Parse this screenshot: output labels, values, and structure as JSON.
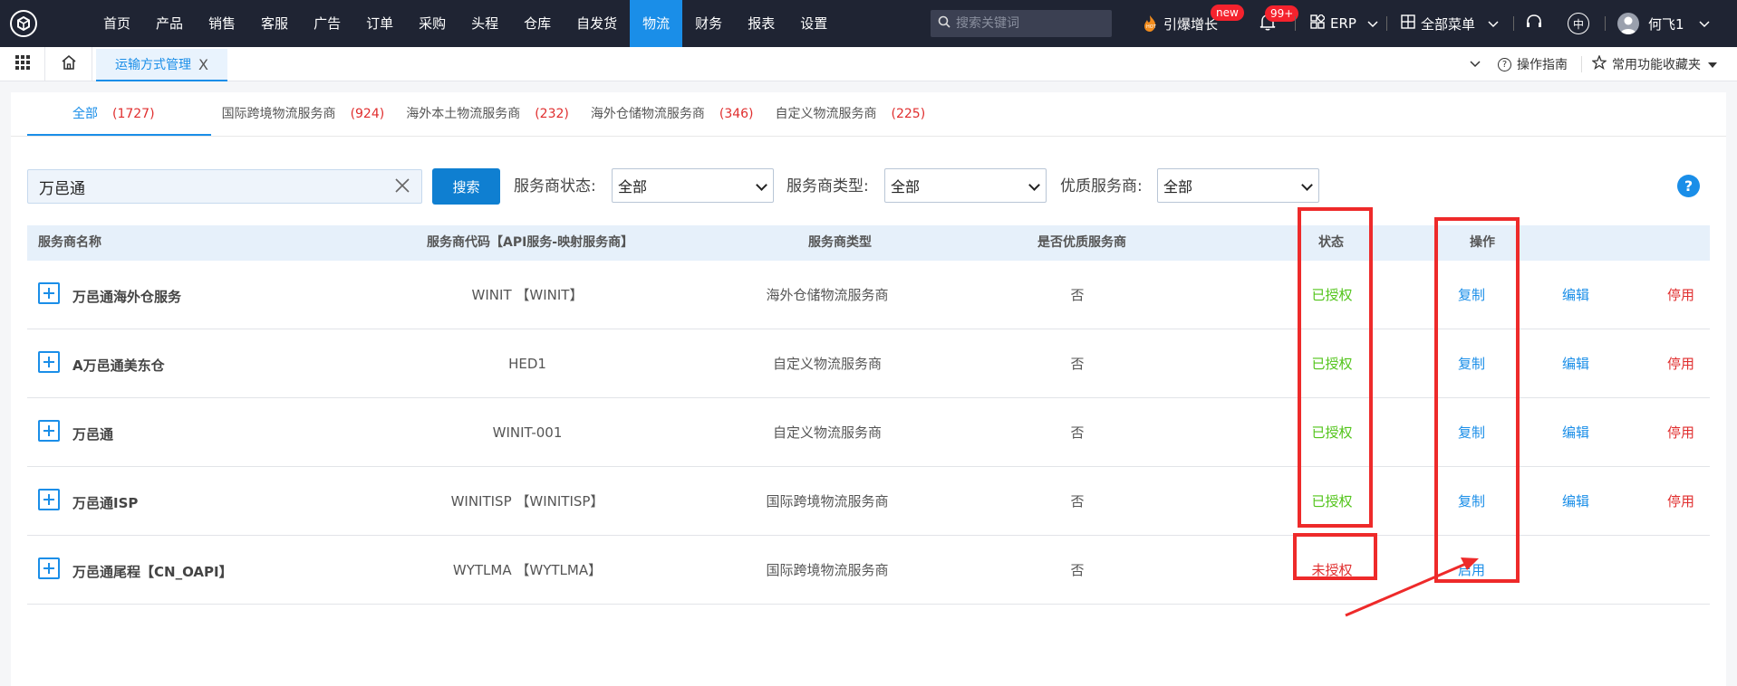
{
  "topnav": {
    "menu": [
      "首页",
      "产品",
      "销售",
      "客服",
      "广告",
      "订单",
      "采购",
      "头程",
      "仓库",
      "自发货",
      "物流",
      "财务",
      "报表",
      "设置"
    ],
    "active_index": 10,
    "search_placeholder": "搜索关键词",
    "growth_label": "引爆增长",
    "growth_badge": "new",
    "notify_badge": "99+",
    "erp_label": "ERP",
    "all_menu_label": "全部菜单",
    "lang_label": "中",
    "user_name": "何飞1"
  },
  "tabbar": {
    "active_tab": "运输方式管理",
    "close_glyph": "X",
    "guide_label": "操作指南",
    "favorites_label": "常用功能收藏夹"
  },
  "subtabs": [
    {
      "label": "全部",
      "count": "(1727)",
      "active": true
    },
    {
      "label": "国际跨境物流服务商",
      "count": "(924)",
      "active": false
    },
    {
      "label": "海外本土物流服务商",
      "count": "(232)",
      "active": false
    },
    {
      "label": "海外仓储物流服务商",
      "count": "(346)",
      "active": false
    },
    {
      "label": "自定义物流服务商",
      "count": "(225)",
      "active": false
    }
  ],
  "filters": {
    "keyword": "万邑通",
    "search_button": "搜索",
    "status_label": "服务商状态:",
    "status_value": "全部",
    "type_label": "服务商类型:",
    "type_value": "全部",
    "quality_label": "优质服务商:",
    "quality_value": "全部",
    "help_glyph": "?"
  },
  "table": {
    "headers": {
      "name": "服务商名称",
      "code": "服务商代码【API服务-映射服务商】",
      "type": "服务商类型",
      "quality": "是否优质服务商",
      "status": "状态",
      "action": "操作"
    },
    "rows": [
      {
        "name": "万邑通海外仓服务",
        "code": "WINIT 【WINIT】",
        "type": "海外仓储物流服务商",
        "quality": "否",
        "status": "已授权",
        "authorized": true,
        "actions": [
          "复制",
          "编辑",
          "停用"
        ]
      },
      {
        "name": "A万邑通美东仓",
        "code": "HED1",
        "type": "自定义物流服务商",
        "quality": "否",
        "status": "已授权",
        "authorized": true,
        "actions": [
          "复制",
          "编辑",
          "停用"
        ]
      },
      {
        "name": "万邑通",
        "code": "WINIT-001",
        "type": "自定义物流服务商",
        "quality": "否",
        "status": "已授权",
        "authorized": true,
        "actions": [
          "复制",
          "编辑",
          "停用"
        ]
      },
      {
        "name": "万邑通ISP",
        "code": "WINITISP 【WINITISP】",
        "type": "国际跨境物流服务商",
        "quality": "否",
        "status": "已授权",
        "authorized": true,
        "actions": [
          "复制",
          "编辑",
          "停用"
        ]
      },
      {
        "name": "万邑通尾程【CN_OAPI】",
        "code": "WYTLMA 【WYTLMA】",
        "type": "国际跨境物流服务商",
        "quality": "否",
        "status": "未授权",
        "authorized": false,
        "actions": [
          "启用"
        ]
      }
    ]
  },
  "colors": {
    "nav_bg": "#1f2433",
    "accent": "#1a8ee8",
    "authorized": "#52c41a",
    "danger": "#e02e2e",
    "annotation": "#ee2a2a"
  }
}
